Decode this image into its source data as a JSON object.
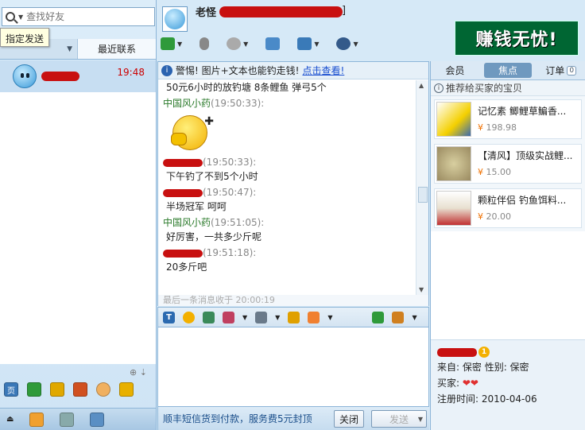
{
  "search": {
    "placeholder": "查找好友"
  },
  "tooltip": {
    "text": "指定发送"
  },
  "contact_tabs": {
    "recent": "最近联系"
  },
  "contact_list": [
    {
      "time": "19:48"
    }
  ],
  "header": {
    "name_visible": "老怪",
    "bracket": "]"
  },
  "banner": {
    "text": "赚钱无忧!"
  },
  "warning": {
    "label": "警惕! 图片+文本也能钓走钱!",
    "link": "点击查看!"
  },
  "messages": [
    {
      "type": "text",
      "text": "50元6小时的放钓塘 8条鲤鱼 弹弓5个"
    },
    {
      "type": "sender",
      "name": "中国风小药",
      "time": "(19:50:33):",
      "style": "green"
    },
    {
      "type": "emoticon"
    },
    {
      "type": "sender",
      "name": "",
      "time": "(19:50:33):",
      "style": "red"
    },
    {
      "type": "text",
      "text": "下午钓了不到5个小时"
    },
    {
      "type": "sender",
      "name": "",
      "time": "(19:50:47):",
      "style": "red"
    },
    {
      "type": "text",
      "text": "半场冠军 呵呵"
    },
    {
      "type": "sender",
      "name": "中国风小药",
      "time": "(19:51:05):",
      "style": "green"
    },
    {
      "type": "text",
      "text": "好厉害，一共多少斤呢"
    },
    {
      "type": "sender",
      "name": "",
      "time": "(19:51:18):",
      "style": "red"
    },
    {
      "type": "text",
      "text": "20多斤吧"
    }
  ],
  "last_message": "最后一条消息收于 20:00:19",
  "send_bar": {
    "hint": "顺丰短信货到付款，服务费5元封顶",
    "close": "关闭",
    "send": "发送"
  },
  "right_tabs": {
    "member": "会员",
    "focus": "焦点",
    "order": "订单",
    "order_count": "0"
  },
  "recommend_title": "推荐给买家的宝贝",
  "products": [
    {
      "name": "记忆素 鲫鲤草鳊香...",
      "price_symbol": "¥",
      "price": "198.98"
    },
    {
      "name": "【清风】顶级实战鲤...",
      "price_symbol": "¥",
      "price": "15.00"
    },
    {
      "name": "颗粒伴侣 钓鱼饵料...",
      "price_symbol": "¥",
      "price": "20.00"
    }
  ],
  "seller": {
    "origin": "来自: 保密",
    "gender": "性别: 保密",
    "buyer_label": "买家:",
    "registered": "注册时间: 2010-04-06"
  },
  "colors": {
    "accent": "#6f99bf",
    "price": "#f07000",
    "sender_green": "#2a7a2a",
    "redaction": "#c81010"
  }
}
